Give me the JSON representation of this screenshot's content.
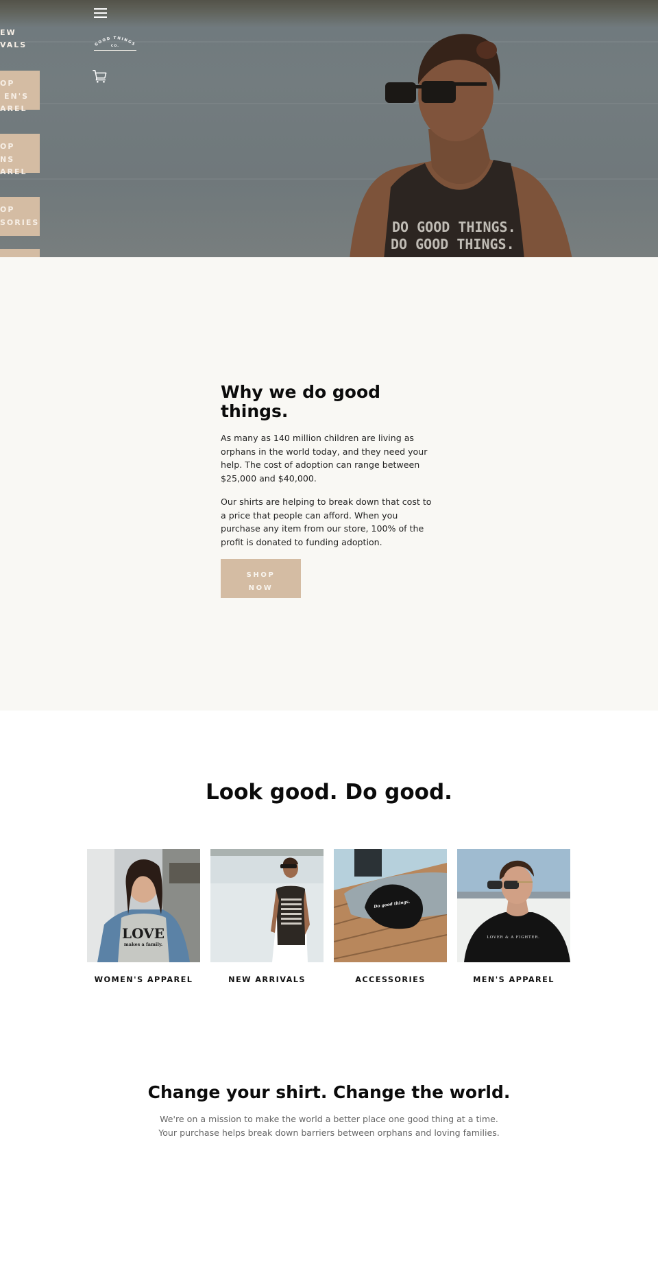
{
  "header": {
    "menu_icon": "hamburger-menu-icon",
    "logo_text_top": "GOOD THINGS",
    "logo_text_bottom": "CO.",
    "cart_icon": "shopping-cart-icon"
  },
  "side_nav": {
    "items": [
      {
        "line1": "NEW",
        "line2": "ARRIVALS",
        "visible_line1": "EW",
        "visible_line2": "VALS"
      },
      {
        "line1": "SHOP",
        "line2": "WOMEN'S",
        "line3": "APPAREL",
        "visible_line1": "OP",
        "visible_line2": "EN'S",
        "visible_line3": "AREL"
      },
      {
        "line1": "SHOP",
        "line2": "MEN'S",
        "line3": "APPAREL",
        "visible_line1": "OP",
        "visible_line2": "NS",
        "visible_line3": "AREL"
      },
      {
        "line1": "SHOP",
        "line2": "ACCESSORIES",
        "visible_line1": "OP",
        "visible_line2": "SORIES"
      }
    ]
  },
  "hero": {
    "image_alt": "Man in sunglasses wearing a DO GOOD THINGS tank top on the beach",
    "shirt_text": "DO GOOD THINGS."
  },
  "why": {
    "title": "Why we do good things.",
    "paragraph1": "As many as 140 million children are living as orphans in the world today, and they need your help. The cost of adoption can range between $25,000 and $40,000.",
    "paragraph2": "Our shirts are helping to break down that cost to a price that people can afford. When you purchase any item from our store, 100% of the profit is donated to funding adoption.",
    "button_line1": "SHOP",
    "button_line2": "NOW"
  },
  "collections": {
    "title": "Look good. Do good.",
    "items": [
      {
        "label": "WOMEN'S APPAREL",
        "image_alt": "Woman wearing LOVE makes a family tee",
        "shirt_text": "LOVE",
        "shirt_sub": "makes a family."
      },
      {
        "label": "NEW ARRIVALS",
        "image_alt": "Man in DO GOOD THINGS tank on the beach"
      },
      {
        "label": "ACCESSORIES",
        "image_alt": "Black Do good things cap on a bench",
        "cap_text": "Do good things."
      },
      {
        "label": "MEN'S APPAREL",
        "image_alt": "Man in LOVER & A FIGHTER tee",
        "shirt_text": "LOVER & A FIGHTER."
      }
    ]
  },
  "mission": {
    "title": "Change your shirt. Change the world.",
    "text": "We're on a mission to make the world a better place one good thing at a time. Your purchase helps break down barriers between orphans and loving families."
  },
  "colors": {
    "accent": "#d4bca3",
    "why_background": "#f9f8f4",
    "heading": "#0b0b0b",
    "muted_text": "#666666"
  }
}
